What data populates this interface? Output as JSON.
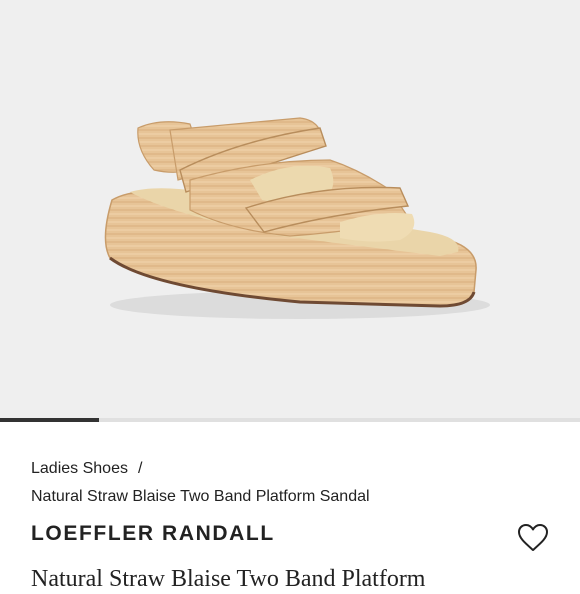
{
  "product_image": {
    "alt": "",
    "gallery_position": 0.17
  },
  "breadcrumb": {
    "category": "Ladies Shoes",
    "separator": "/",
    "current": "Natural Straw Blaise Two Band Platform Sandal"
  },
  "brand": "LOEFFLER RANDALL",
  "title": "Natural Straw Blaise Two Band Platform",
  "icons": {
    "like": "heart-outline-icon"
  },
  "colors": {
    "image_background": "#efefef",
    "text": "#222222",
    "progress": "#333333"
  }
}
